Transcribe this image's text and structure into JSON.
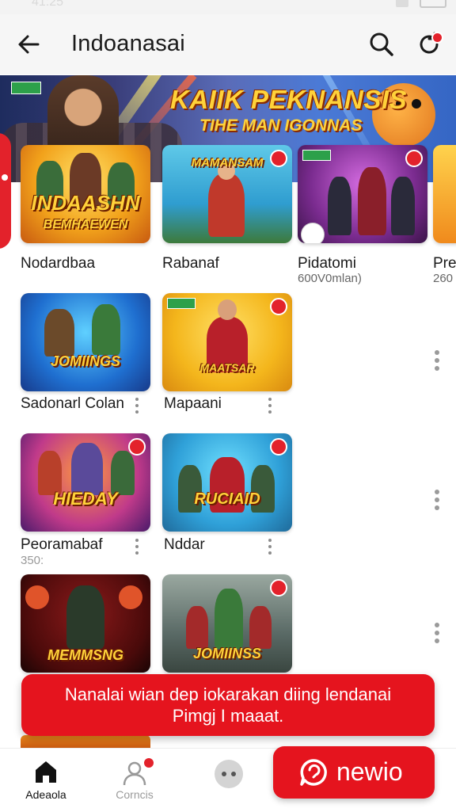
{
  "status_bar": {
    "time": "41:25"
  },
  "header": {
    "title": "Indoanasai"
  },
  "banner": {
    "line1": "KAIIK PEKNANSIS",
    "line2": "TIHE MAN IGONNAS"
  },
  "grid": [
    {
      "title": "Nodardbaa",
      "art_line1": "INDAASHN",
      "art_line2": "BEMHAEWEN"
    },
    {
      "title": "Rabanaf",
      "art_line1": "MAMANSAM"
    },
    {
      "title": "Pidatomi",
      "subtitle": "600V0mlan)"
    },
    {
      "title": "Pre",
      "subtitle": "260"
    },
    {
      "title": "Sadonarl Colan",
      "art_line1": "JOMIINGS"
    },
    {
      "title": "Mapaani",
      "art_line1": "MAATSAR"
    },
    {
      "title": "Peoramabaf",
      "subtitle": "350:",
      "art_line1": "HIEDAY"
    },
    {
      "title": "Nddar",
      "art_line1": "RUCIAID"
    },
    {
      "title": "",
      "art_line1": "MEMMSNG"
    },
    {
      "title": "",
      "art_line1": "JOMIINSS"
    }
  ],
  "toast": {
    "line1": "Nanalai wian dep iokarakan diing lendanai",
    "line2": "Pimgj I maaat."
  },
  "bottom_nav": {
    "home_label": "Adeaola",
    "contacts_label": "Corncis"
  },
  "fab": {
    "label": "newio"
  },
  "colors": {
    "accent": "#e5141e",
    "banner_text": "#ffd23a",
    "background": "#ffffff"
  }
}
